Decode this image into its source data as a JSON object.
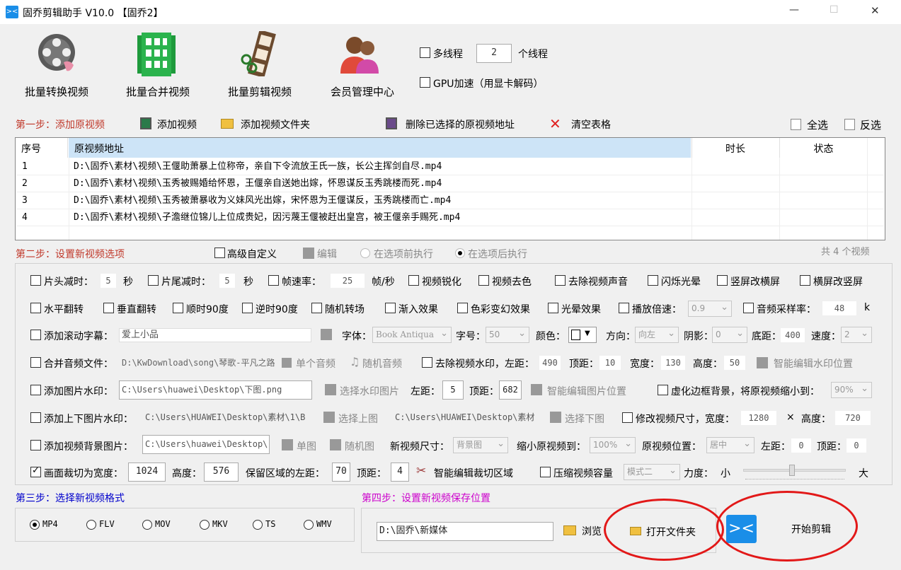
{
  "window": {
    "title": "固乔剪辑助手 V10.0 【固乔2】",
    "min": "—",
    "max": "☐",
    "close": "✕"
  },
  "toolbar": {
    "batch_convert": "批量转换视频",
    "batch_merge": "批量合并视频",
    "batch_cut": "批量剪辑视频",
    "member_center": "会员管理中心"
  },
  "thread": {
    "multi_label": "多线程",
    "count": "2",
    "unit": "个线程",
    "gpu_label": "GPU加速（用显卡解码）"
  },
  "step1": {
    "title": "第一步：添加原视频",
    "add_video": "添加视频",
    "add_folder": "添加视频文件夹",
    "delete_selected": "删除已选择的原视频地址",
    "clear_table": "清空表格",
    "select_all": "全选",
    "invert": "反选"
  },
  "table": {
    "headers": [
      "序号",
      "原视频地址",
      "时长",
      "状态"
    ],
    "rows": [
      {
        "no": "1",
        "path": "D:\\固乔\\素材\\视频\\王偃助萧暴上位称帝，亲自下令流放王氏一族，长公主挥剑自尽.mp4"
      },
      {
        "no": "2",
        "path": "D:\\固乔\\素材\\视频\\玉秀被赐婚给怀恩，王偃亲自送她出嫁，怀恩谋反玉秀跳楼而死.mp4"
      },
      {
        "no": "3",
        "path": "D:\\固乔\\素材\\视频\\玉秀被萧暴收为义妹风光出嫁，宋怀恩为王偃谋反，玉秀跳楼而亡.mp4"
      },
      {
        "no": "4",
        "path": "D:\\固乔\\素材\\视频\\子澹继位锦儿上位成贵妃，因污蔑王偃被赶出皇宫，被王偃亲手赐死.mp4"
      }
    ]
  },
  "step2": {
    "title": "第二步：设置新视频选项",
    "advanced": "高级自定义",
    "edit": "编辑",
    "before": "在选项前执行",
    "after": "在选项后执行",
    "total": "共 4 个视频"
  },
  "opts": {
    "head_cut": "片头减时：",
    "head_val": "5",
    "sec1": "秒",
    "tail_cut": "片尾减时：",
    "tail_val": "5",
    "sec2": "秒",
    "fps": "帧速率：",
    "fps_val": "25",
    "fps_unit": "帧/秒",
    "sharpen": "视频锐化",
    "decolor": "视频去色",
    "mute": "去除视频声音",
    "flash": "闪烁光晕",
    "h2v": "竖屏改横屏",
    "v2h": "横屏改竖屏",
    "hflip": "水平翻转",
    "vflip": "垂直翻转",
    "cw90": "顺时90度",
    "ccw90": "逆时90度",
    "random_trans": "随机转场",
    "fadein": "渐入效果",
    "color_fx": "色彩变幻效果",
    "halo": "光晕效果",
    "speed": "播放倍速：",
    "speed_val": "0.9",
    "sample": "音频采样率：",
    "sample_val": "48",
    "sample_unit": "k",
    "scroll": "添加滚动字幕：",
    "scroll_val": "爱上小品",
    "font": "字体：",
    "font_val": "Book Antiqua",
    "size": "字号：",
    "size_val": "50",
    "color": "颜色：",
    "dir": "方向：",
    "dir_val": "向左",
    "shadow": "阴影：",
    "shadow_val": "0",
    "bottom": "底距：",
    "bottom_val": "400",
    "spd": "速度：",
    "spd_val": "2",
    "merge_audio": "合并音频文件：",
    "audio_path": "D:\\KwDownload\\song\\琴歌-平凡之路",
    "single_audio": "单个音频",
    "random_audio": "随机音频",
    "remove_wm": "去除视频水印，左距：",
    "wm_left": "490",
    "wm_top_l": "顶距：",
    "wm_top": "10",
    "wm_w_l": "宽度：",
    "wm_w": "130",
    "wm_h_l": "高度：",
    "wm_h": "50",
    "wm_smart": "智能编辑水印位置",
    "img_wm": "添加图片水印：",
    "img_path": "C:\\Users\\huawei\\Desktop\\下图.png",
    "sel_img": "选择水印图片",
    "left_l": "左距：",
    "left_v": "5",
    "top_l": "顶距：",
    "top_v": "682",
    "img_smart": "智能编辑图片位置",
    "blur_bg": "虚化边框背景，将原视频缩小到：",
    "blur_val": "90%",
    "tb_wm": "添加上下图片水印：",
    "up_path": "C:\\Users\\HUAWEI\\Desktop\\素材\\1\\B",
    "sel_up": "选择上图",
    "down_path": "C:\\Users\\HUAWEI\\Desktop\\素材",
    "sel_down": "选择下图",
    "resize": "修改视频尺寸，宽度：",
    "rw": "1280",
    "x": "×",
    "rh_l": "高度：",
    "rh": "720",
    "bg_img": "添加视频背景图片：",
    "bg_path": "C:\\Users\\huawei\\Desktop\\",
    "single_img": "单图",
    "random_img": "随机图",
    "new_size": "新视频尺寸：",
    "new_size_val": "背景图",
    "shrink": "缩小原视频到：",
    "shrink_val": "100%",
    "pos": "原视频位置：",
    "pos_val": "居中",
    "pl": "左距：",
    "pl_v": "0",
    "pt": "顶距：",
    "pt_v": "0",
    "crop": "画面裁切为宽度：",
    "crop_w": "1024",
    "crop_h_l": "高度：",
    "crop_h": "576",
    "keep_left": "保留区域的左距：",
    "keep_left_v": "70",
    "keep_top": "顶距：",
    "keep_top_v": "4",
    "crop_smart": "智能编辑裁切区域",
    "compress": "压缩视频容量",
    "mode_val": "模式二",
    "strength": "力度：",
    "small": "小",
    "big": "大"
  },
  "step3": {
    "title": "第三步：选择新视频格式",
    "formats": [
      "MP4",
      "FLV",
      "MOV",
      "MKV",
      "TS",
      "WMV"
    ]
  },
  "step4": {
    "title": "第四步：设置新视频保存位置",
    "path": "D:\\固乔\\新媒体",
    "browse": "浏览",
    "open_folder": "打开文件夹",
    "start": "开始剪辑"
  }
}
